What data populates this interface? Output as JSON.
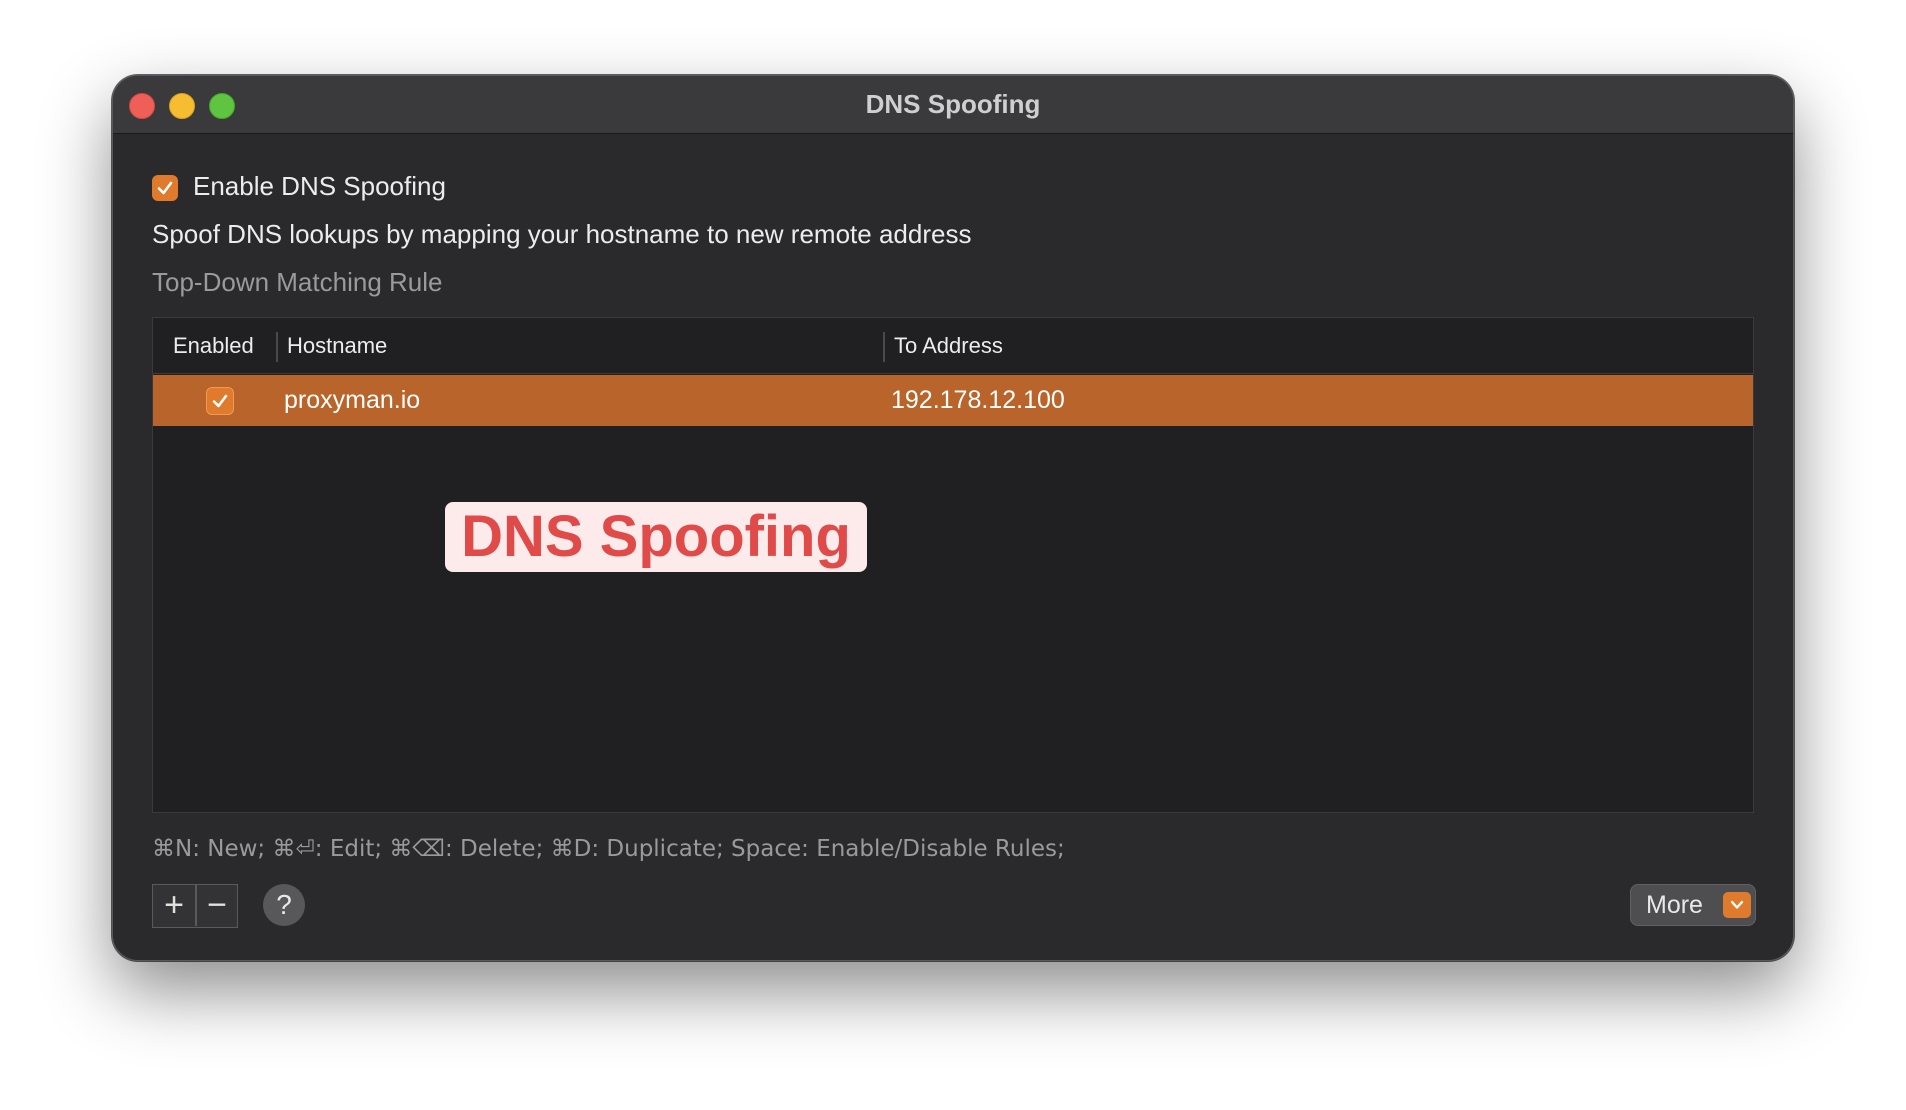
{
  "window": {
    "title": "DNS Spoofing"
  },
  "settings": {
    "enable_label": "Enable DNS Spoofing",
    "enable_checked": true,
    "description": "Spoof DNS lookups by mapping your hostname to new remote address",
    "subtitle": "Top-Down Matching Rule"
  },
  "table": {
    "columns": [
      "Enabled",
      "Hostname",
      "To Address"
    ],
    "rows": [
      {
        "enabled": true,
        "hostname": "proxyman.io",
        "address": "192.178.12.100"
      }
    ]
  },
  "overlay_label": "DNS Spoofing",
  "shortcuts": "⌘N: New; ⌘⏎: Edit; ⌘⌫: Delete; ⌘D: Duplicate; Space: Enable/Disable Rules;",
  "footer": {
    "add_symbol": "+",
    "remove_symbol": "−",
    "help_symbol": "?",
    "more_label": "More"
  },
  "colors": {
    "accent": "#e07a2c",
    "selected_row": "#b8642a",
    "window_bg": "#2a2a2c",
    "overlay_text": "#e04a48"
  }
}
